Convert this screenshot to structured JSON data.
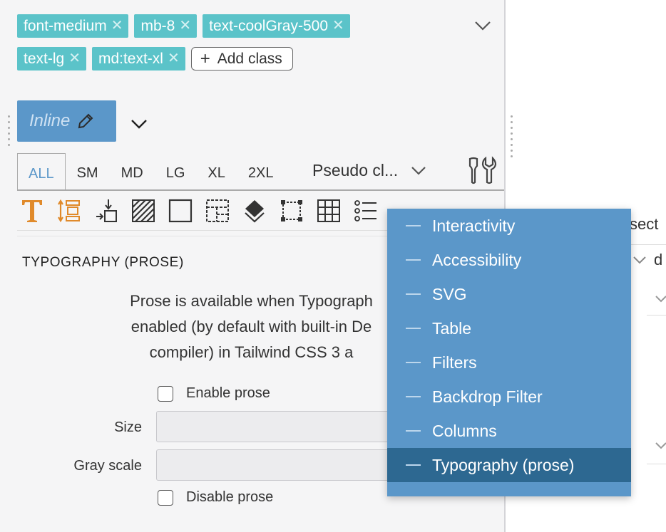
{
  "classes": {
    "chips": [
      {
        "label": "font-medium"
      },
      {
        "label": "mb-8"
      },
      {
        "label": "text-coolGray-500"
      },
      {
        "label": "text-lg"
      },
      {
        "label": "md:text-xl"
      }
    ],
    "add_label": "Add class"
  },
  "state": {
    "inline_label": "Inline"
  },
  "breakpoints": [
    "ALL",
    "SM",
    "MD",
    "LG",
    "XL",
    "2XL"
  ],
  "pseudo_label": "Pseudo cl...",
  "prop_icons": [
    "typography-icon",
    "spacing-icon",
    "position-icon",
    "background-icon",
    "border-icon",
    "layout-icon",
    "effects-icon",
    "flexbox-icon",
    "grid-icon",
    "list-icon"
  ],
  "section": {
    "title": "TYPOGRAPHY (PROSE)",
    "prose_line1": "Prose is available when Typograph",
    "prose_line2": "enabled (by default with built-in De",
    "prose_line3": "compiler) in Tailwind CSS 3 a",
    "enable_label": "Enable prose",
    "size_label": "Size",
    "gray_label": "Gray scale",
    "disable_label": "Disable prose"
  },
  "right": {
    "frag1": "sect",
    "frag2": "d"
  },
  "menu": {
    "items": [
      "Interactivity",
      "Accessibility",
      "SVG",
      "Table",
      "Filters",
      "Backdrop Filter",
      "Columns",
      "Typography (prose)"
    ],
    "selected": "Typography (prose)"
  },
  "colors": {
    "chip": "#5bc3c9",
    "accent": "#5b97c9",
    "menu_selected": "#2d6891"
  }
}
